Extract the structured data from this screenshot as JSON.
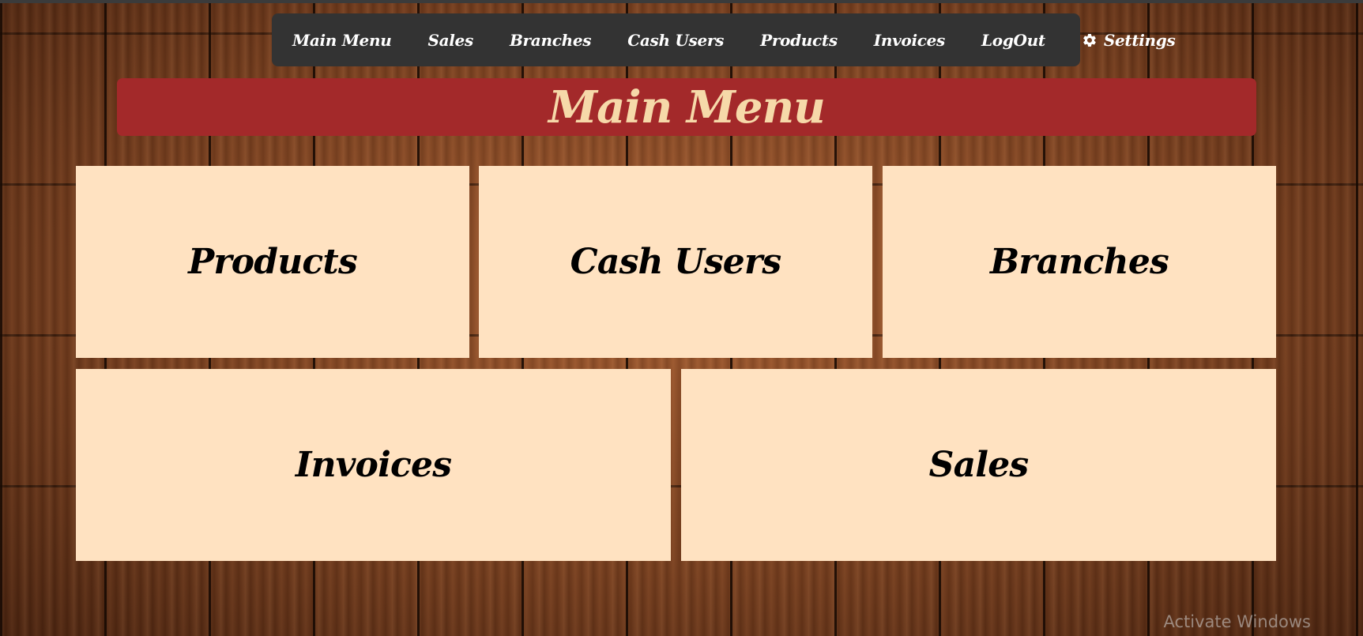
{
  "nav": {
    "items": [
      {
        "label": "Main Menu"
      },
      {
        "label": "Sales"
      },
      {
        "label": "Branches"
      },
      {
        "label": "Cash Users"
      },
      {
        "label": "Products"
      },
      {
        "label": "Invoices"
      },
      {
        "label": "LogOut"
      },
      {
        "label": "Settings",
        "icon": "gear-icon"
      }
    ]
  },
  "header": {
    "title": "Main Menu"
  },
  "tiles": [
    {
      "label": "Products"
    },
    {
      "label": "Cash Users"
    },
    {
      "label": "Branches"
    },
    {
      "label": "Invoices"
    },
    {
      "label": "Sales"
    }
  ],
  "watermark": "Activate Windows",
  "colors": {
    "navbar": "#333333",
    "banner": "#a3292a",
    "banner_text": "#f6d9a9",
    "tile": "#ffe2c1",
    "tile_text": "#000000",
    "nav_text": "#ffffff"
  }
}
